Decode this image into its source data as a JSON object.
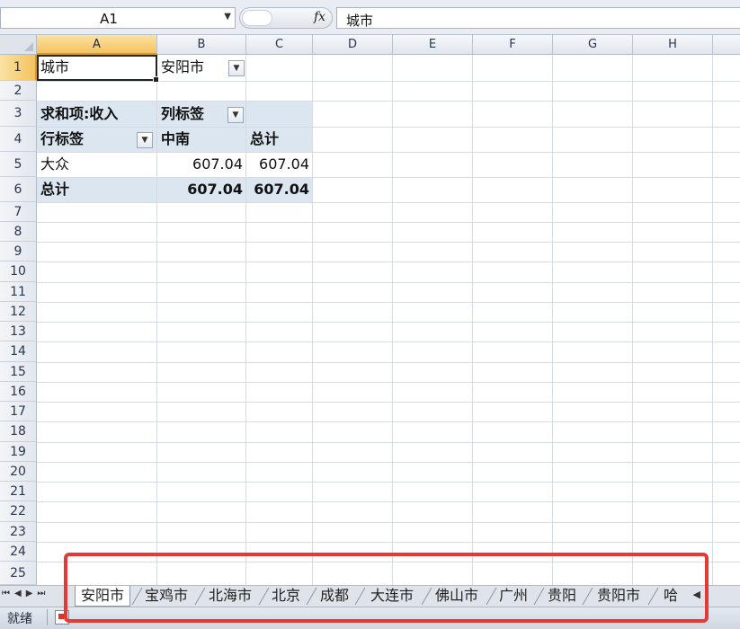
{
  "formula_bar": {
    "name_box": "A1",
    "fx_label": "fx",
    "formula": "城市"
  },
  "columns": [
    "A",
    "B",
    "C",
    "D",
    "E",
    "F",
    "G",
    "H"
  ],
  "rows": [
    "1",
    "2",
    "3",
    "4",
    "5",
    "6",
    "7",
    "8",
    "9",
    "10",
    "11",
    "12",
    "13",
    "14",
    "15",
    "16",
    "17",
    "18",
    "19",
    "20",
    "21",
    "22",
    "23",
    "24",
    "25"
  ],
  "cells": {
    "a1": "城市",
    "b1": "安阳市",
    "a3": "求和项:收入",
    "b3": "列标签",
    "a4": "行标签",
    "b4": "中南",
    "c4": "总计",
    "a5": "大众",
    "b5": "607.04",
    "c5": "607.04",
    "a6": "总计",
    "b6": "607.04",
    "c6": "607.04"
  },
  "sheet_tabs": [
    "安阳市",
    "宝鸡市",
    "北海市",
    "北京",
    "成都",
    "大连市",
    "佛山市",
    "广州",
    "贵阳",
    "贵阳市",
    "哈"
  ],
  "active_tab_index": 0,
  "status": {
    "ready": "就绪"
  },
  "highlight_color": "#e53935"
}
